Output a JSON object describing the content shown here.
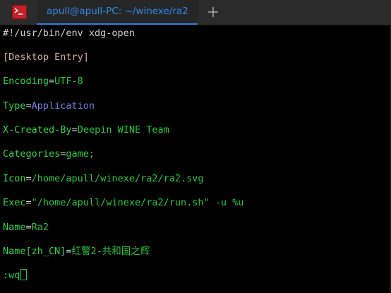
{
  "tab": {
    "title": "apull@apull-PC: ~/winexe/ra2"
  },
  "icons": {
    "app": "terminal-icon",
    "new_tab": "plus-icon"
  },
  "editor": {
    "shebang": "#!/usr/bin/env xdg-open",
    "section": "[Desktop Entry]",
    "entries": [
      {
        "key": "Encoding",
        "eq": "=",
        "value": "UTF-8"
      },
      {
        "key": "Type",
        "eq": "=",
        "value": "Application"
      },
      {
        "key": "X-Created-By",
        "eq": "=",
        "value": "Deepin WINE Team"
      },
      {
        "key": "Categories",
        "eq": "=",
        "value": "game;"
      },
      {
        "key": "Icon",
        "eq": "=",
        "value": "/home/apull/winexe/ra2/ra2.svg"
      },
      {
        "key": "Exec",
        "eq": "=",
        "value": "\"/home/apull/winexe/ra2/run.sh\" -u %u"
      },
      {
        "key": "Name",
        "eq": "=",
        "value": "Ra2"
      },
      {
        "key": "Name[zh_CN]",
        "eq": "=",
        "value": "红警2-共和国之辉"
      }
    ],
    "command": ":wq"
  },
  "colors": {
    "accent": "#2f7ddb",
    "key_green": "#30d545",
    "value_green": "#27c93f",
    "value_purple": "#7a7be0",
    "icon_red": "#c81e28"
  }
}
